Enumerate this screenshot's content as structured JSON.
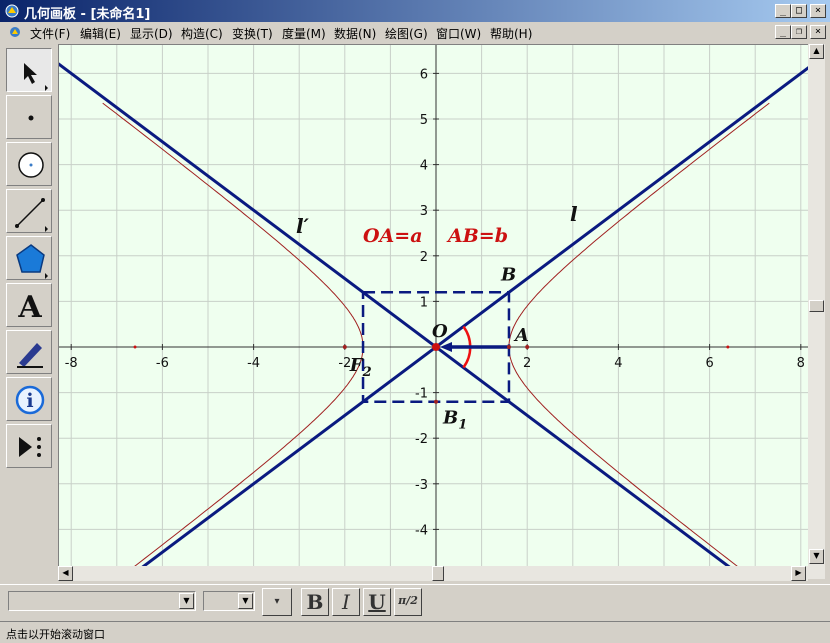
{
  "window": {
    "title": "几何画板 - [未命名1]",
    "minimize": "_",
    "maximize": "□",
    "close": "×",
    "doc_minimize": "_",
    "doc_restore": "❐",
    "doc_close": "×"
  },
  "menu": [
    "文件(F)",
    "编辑(E)",
    "显示(D)",
    "构造(C)",
    "变换(T)",
    "度量(M)",
    "数据(N)",
    "绘图(G)",
    "窗口(W)",
    "帮助(H)"
  ],
  "toolbox": [
    {
      "name": "arrow-tool-icon",
      "active": true
    },
    {
      "name": "point-tool-icon"
    },
    {
      "name": "compass-tool-icon"
    },
    {
      "name": "line-tool-icon"
    },
    {
      "name": "polygon-tool-icon"
    },
    {
      "name": "text-tool-icon",
      "glyph": "A"
    },
    {
      "name": "marker-tool-icon"
    },
    {
      "name": "info-tool-icon",
      "glyph": "i"
    },
    {
      "name": "custom-tool-icon"
    }
  ],
  "canvas": {
    "x_ticks": [
      "-8",
      "-6",
      "-4",
      "-2",
      "2",
      "4",
      "6",
      "8"
    ],
    "y_ticks": [
      "6",
      "5",
      "4",
      "3",
      "2",
      "1",
      "-1",
      "-2",
      "-3",
      "-4"
    ],
    "labels": {
      "origin": "O",
      "A": "A",
      "B": "B",
      "B1": "B",
      "B1_sub": "1",
      "F2": "F",
      "F2_sub": "2",
      "l": "l",
      "l_prime": "l′",
      "eq1": "OA=a",
      "eq2": "AB=b"
    },
    "colors": {
      "background": "#efffef",
      "grid": "#c8d0c8",
      "asymptote": "#0a1a80",
      "hyperbola": "#a02020",
      "label_red": "#cc1111"
    },
    "math": {
      "a": 1.6,
      "b": 1.2,
      "xlim": [
        -8.3,
        8.3
      ],
      "ylim": [
        -4.9,
        6.6
      ]
    }
  },
  "format_bar": {
    "font_value": "",
    "size_value": "",
    "bold": "B",
    "italic": "I",
    "underline": "U",
    "symbol": "π/2"
  },
  "status": "点击以开始滚动窗口"
}
